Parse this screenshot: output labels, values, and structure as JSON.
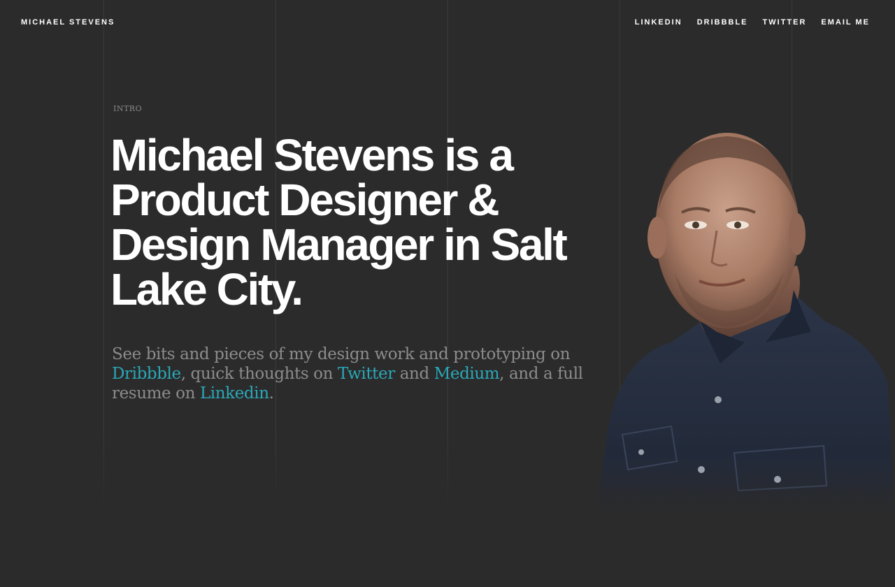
{
  "header": {
    "brand": "MICHAEL STEVENS",
    "nav": [
      {
        "label": "LINKEDIN"
      },
      {
        "label": "DRIBBBLE"
      },
      {
        "label": "TWITTER"
      },
      {
        "label": "EMAIL ME"
      }
    ]
  },
  "intro": {
    "label": "INTRO",
    "headline": "Michael Stevens is a Product Designer & Design Manager in Salt Lake City.",
    "lede": {
      "text_1": "See bits and pieces of my design work and prototyping on ",
      "link_dribbble": "Dribbble",
      "text_2": ", quick thoughts on ",
      "link_twitter": "Twitter",
      "text_3": " and ",
      "link_medium": "Medium",
      "text_4": ", and a full resume on ",
      "link_linkedin": "Linkedin",
      "text_5": "."
    }
  },
  "colors": {
    "background": "#2b2b2b",
    "heading": "#ffffff",
    "body_text": "#8c8c8c",
    "link": "#2aa8b8"
  },
  "icons": {
    "portrait": "portrait-photo"
  }
}
